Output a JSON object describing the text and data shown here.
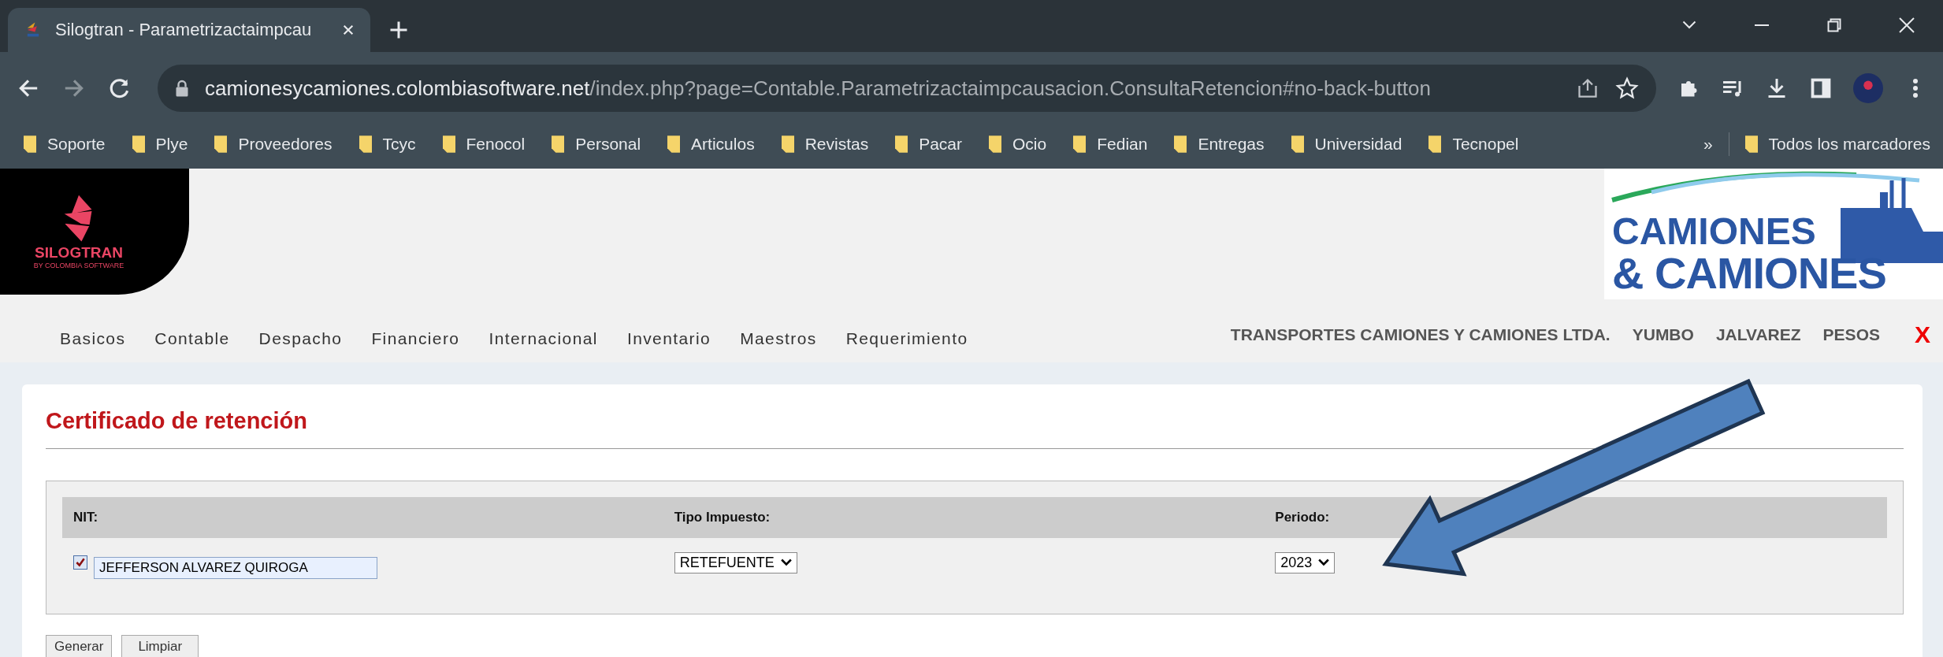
{
  "browser": {
    "tab_title": "Silogtran - Parametrizactaimpcau",
    "url_host": "camionesycamiones.colombiasoftware.net",
    "url_path": "/index.php?page=Contable.Parametrizactaimpcausacion.ConsultaRetencion#no-back-button",
    "bookmarks": [
      "Soporte",
      "Plye",
      "Proveedores",
      "Tcyc",
      "Fenocol",
      "Personal",
      "Articulos",
      "Revistas",
      "Pacar",
      "Ocio",
      "Fedian",
      "Entregas",
      "Universidad",
      "Tecnopel"
    ],
    "overflow": "»",
    "all_bookmarks": "Todos los marcadores"
  },
  "header": {
    "logo_name": "SILOGTRAN",
    "logo_tagline": "BY COLOMBIA SOFTWARE",
    "brand_line_1": "CAMIONES",
    "brand_line_2": "& CAMIONES",
    "menu": [
      "Basicos",
      "Contable",
      "Despacho",
      "Financiero",
      "Internacional",
      "Inventario",
      "Maestros",
      "Requerimiento"
    ],
    "session": [
      "TRANSPORTES CAMIONES Y CAMIONES LTDA.",
      "YUMBO",
      "JALVAREZ",
      "PESOS"
    ],
    "logout": "X"
  },
  "form": {
    "title": "Certificado de retención",
    "columns": [
      "NIT:",
      "Tipo Impuesto:",
      "Periodo:"
    ],
    "nit": {
      "checked": true,
      "value": "JEFFERSON ALVAREZ QUIROGA"
    },
    "tipo_impuesto": "RETEFUENTE",
    "periodo": "2023",
    "buttons": [
      "Generar",
      "Limpiar"
    ]
  }
}
